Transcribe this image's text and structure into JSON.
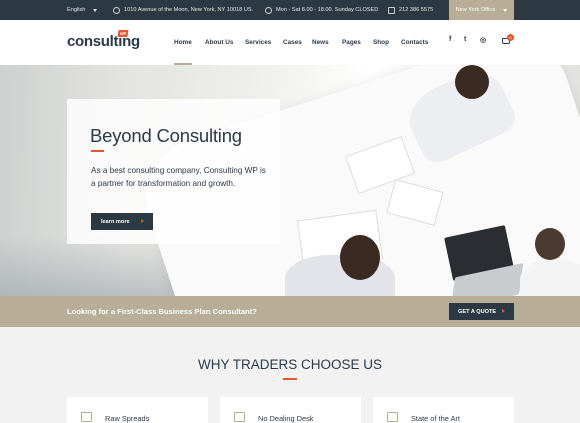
{
  "topbar": {
    "language": "English",
    "address": "1010 Avenue of the Moon, New York, NY 10018 US.",
    "hours": "Mon - Sat 8.00 - 18.00. Sunday CLOSED",
    "phone": "212 386 5575",
    "office": "New York Office"
  },
  "header": {
    "logo": "consulting",
    "logo_badge": "WP",
    "nav": [
      "Home",
      "About Us",
      "Services",
      "Cases",
      "News",
      "Pages",
      "Shop",
      "Contacts"
    ],
    "active_nav": "Home",
    "social": {
      "facebook": "f",
      "twitter": "t",
      "instagram": "◎"
    },
    "cart_count": "0"
  },
  "hero": {
    "title": "Beyond Consulting",
    "text": "As a best consulting company, Consulting WP is a partner for transformation and growth.",
    "button": "learn more"
  },
  "cta": {
    "text": "Looking for a First-Class Business Plan Consultant?",
    "button": "GET A QUOTE"
  },
  "why": {
    "title": "WHY TRADERS CHOOSE US",
    "features": [
      "Raw Spreads",
      "No Dealing Desk",
      "State of the Art"
    ]
  },
  "colors": {
    "dark": "#2c3943",
    "accent": "#e8542b",
    "sand": "#b8ad97"
  }
}
